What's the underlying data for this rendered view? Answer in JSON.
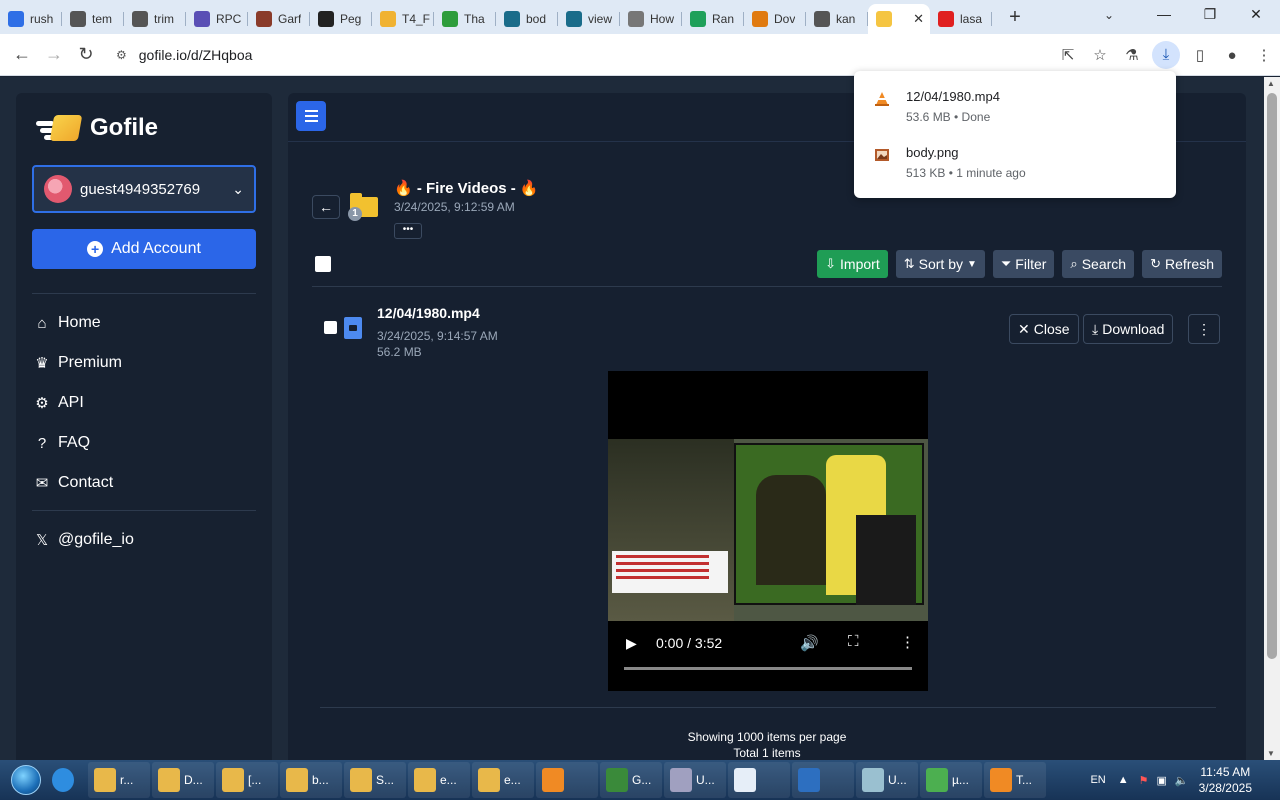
{
  "browser": {
    "tabs": [
      {
        "label": "rush",
        "color": "#2f6fe6"
      },
      {
        "label": "tem",
        "color": "#555555"
      },
      {
        "label": "trim",
        "color": "#555555"
      },
      {
        "label": "RPC",
        "color": "#5a4fb5"
      },
      {
        "label": "Garf",
        "color": "#8a3b2a"
      },
      {
        "label": "Peg",
        "color": "#222222"
      },
      {
        "label": "T4_F",
        "color": "#f0b232"
      },
      {
        "label": "Tha",
        "color": "#2e9d3c"
      },
      {
        "label": "bod",
        "color": "#1a6c8a"
      },
      {
        "label": "view",
        "color": "#1a6c8a"
      },
      {
        "label": "How",
        "color": "#777777"
      },
      {
        "label": "Ran",
        "color": "#1fa05a"
      },
      {
        "label": "Dov",
        "color": "#e07a10"
      },
      {
        "label": "kan",
        "color": "#555555"
      },
      {
        "label": "",
        "color": "#f5c542",
        "active": true
      },
      {
        "label": "lasa",
        "color": "#e02020"
      }
    ],
    "url": "gofile.io/d/ZHqboa",
    "downloads": [
      {
        "name": "12/04/1980.mp4",
        "meta": "53.6 MB • Done",
        "icon": "vlc-cone-icon"
      },
      {
        "name": "body.png",
        "meta": "513 KB • 1 minute ago",
        "icon": "image-file-icon"
      }
    ]
  },
  "sidebar": {
    "logo": "Gofile",
    "account": "guest4949352769",
    "add_account": "Add Account",
    "menu": [
      {
        "label": "Home",
        "icon": "home-icon"
      },
      {
        "label": "Premium",
        "icon": "crown-icon"
      },
      {
        "label": "API",
        "icon": "gears-icon"
      },
      {
        "label": "FAQ",
        "icon": "question-icon"
      },
      {
        "label": "Contact",
        "icon": "envelope-icon"
      }
    ],
    "social": "@gofile_io"
  },
  "folder": {
    "title": "🔥 - Fire Videos - 🔥",
    "date": "3/24/2025, 9:12:59 AM",
    "count_badge": "1",
    "more": "•••"
  },
  "toolbar": {
    "import": "Import",
    "sort": "Sort by",
    "filter": "Filter",
    "search": "Search",
    "refresh": "Refresh"
  },
  "file": {
    "name": "12/04/1980.mp4",
    "date": "3/24/2025, 9:14:57 AM",
    "size": "56.2 MB",
    "close": "Close",
    "download": "Download"
  },
  "video": {
    "time": "0:00 / 3:52"
  },
  "pagination": {
    "per_page": "Showing 1000 items per page",
    "total": "Total 1 items"
  },
  "taskbar": {
    "items": [
      {
        "label": "r...",
        "color": "#e8b84a"
      },
      {
        "label": "D...",
        "color": "#e8b84a"
      },
      {
        "label": "[...",
        "color": "#e8b84a"
      },
      {
        "label": "b...",
        "color": "#e8b84a"
      },
      {
        "label": "S...",
        "color": "#e8b84a"
      },
      {
        "label": "e...",
        "color": "#e8b84a"
      },
      {
        "label": "e...",
        "color": "#e8b84a"
      },
      {
        "label": "",
        "color": "#f08a24"
      },
      {
        "label": "G...",
        "color": "#3a8a3a"
      },
      {
        "label": "U...",
        "color": "#a0a0c0"
      },
      {
        "label": "",
        "color": "#e6eef8"
      },
      {
        "label": "",
        "color": "#2d6fc0"
      },
      {
        "label": "U...",
        "color": "#9ac0d0"
      },
      {
        "label": "µ...",
        "color": "#4caf50"
      },
      {
        "label": "T...",
        "color": "#f08a24"
      }
    ],
    "lang": "EN",
    "time": "11:45 AM",
    "date": "3/28/2025"
  }
}
